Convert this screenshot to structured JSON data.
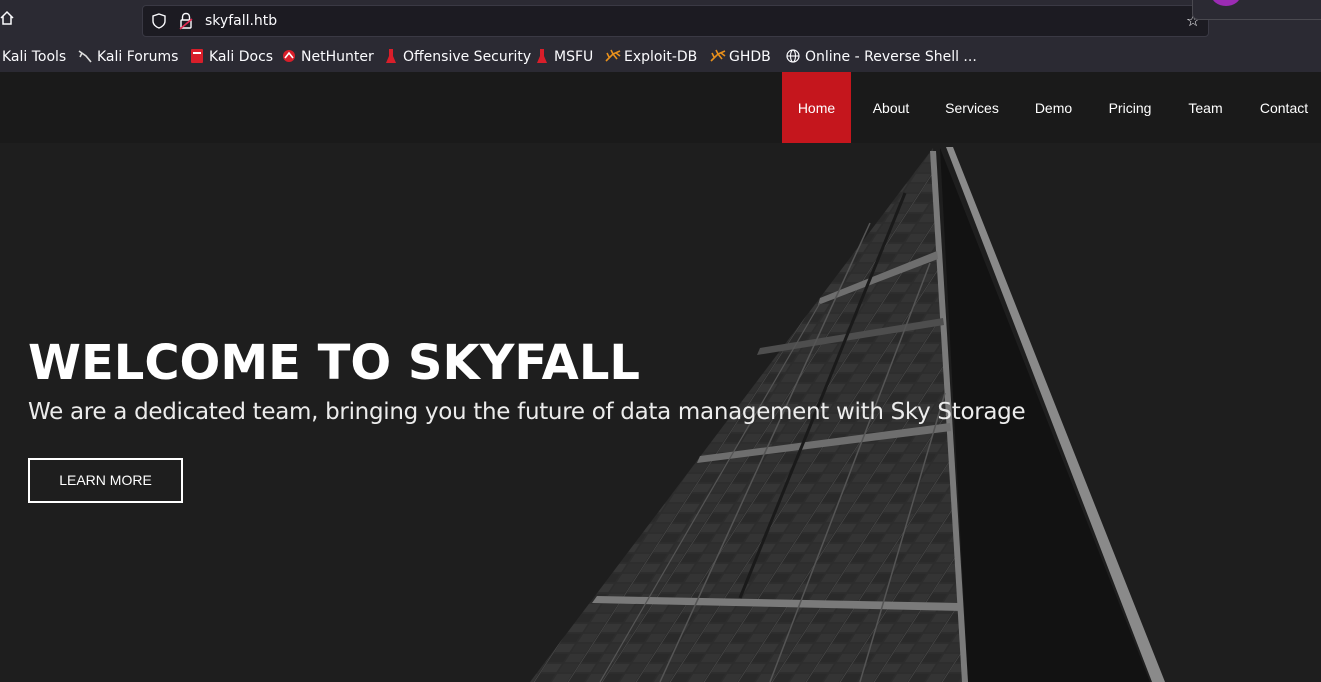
{
  "browser": {
    "url": "skyfall.htb",
    "bookmarks": [
      {
        "label": "Kali Tools",
        "icon": "kali-icon"
      },
      {
        "label": "Kali Forums",
        "icon": "kali-dragon-icon"
      },
      {
        "label": "Kali Docs",
        "icon": "kali-docs-icon"
      },
      {
        "label": "NetHunter",
        "icon": "nethunter-icon"
      },
      {
        "label": "Offensive Security",
        "icon": "offsec-icon"
      },
      {
        "label": "MSFU",
        "icon": "offsec-icon"
      },
      {
        "label": "Exploit-DB",
        "icon": "exploitdb-icon"
      },
      {
        "label": "GHDB",
        "icon": "exploitdb-icon"
      },
      {
        "label": "Online - Reverse Shell ...",
        "icon": "globe-icon"
      }
    ]
  },
  "nav": {
    "items": [
      {
        "label": "Home",
        "active": true
      },
      {
        "label": "About"
      },
      {
        "label": "Services"
      },
      {
        "label": "Demo"
      },
      {
        "label": "Pricing"
      },
      {
        "label": "Team"
      },
      {
        "label": "Contact"
      }
    ]
  },
  "hero": {
    "title": "WELCOME TO SKYFALL",
    "subtitle": "We are a dedicated team, bringing you the future of data management with Sky Storage",
    "button": "LEARN MORE"
  },
  "colors": {
    "accent": "#c5161d",
    "chrome_bg": "#2b2a33",
    "site_bg": "#1a1a1a"
  }
}
